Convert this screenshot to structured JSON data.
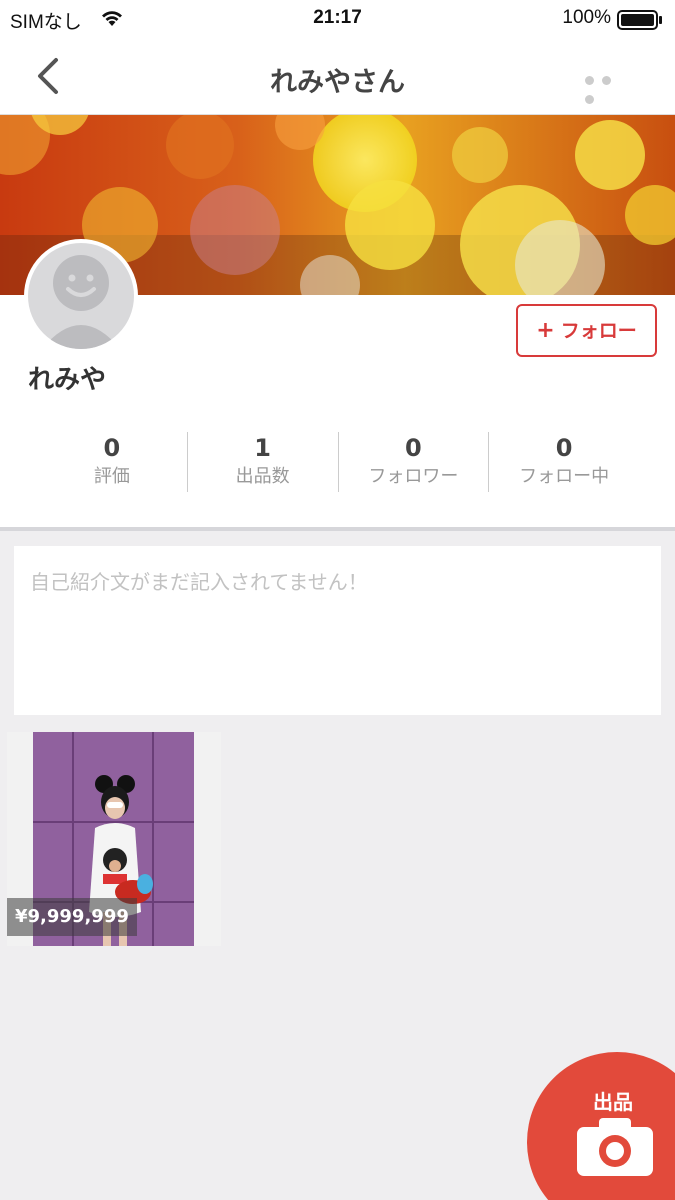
{
  "status_bar": {
    "carrier": "SIMなし",
    "time": "21:17",
    "battery_pct": "100%"
  },
  "nav": {
    "title": "れみやさん",
    "back_icon": "chevron-left-icon",
    "more_icon": "more-horizontal-icon"
  },
  "profile": {
    "name": "れみや",
    "follow_label": "フォロー",
    "follow_plus": "+"
  },
  "stats": [
    {
      "value": "0",
      "label": "評価"
    },
    {
      "value": "1",
      "label": "出品数"
    },
    {
      "value": "0",
      "label": "フォロワー"
    },
    {
      "value": "0",
      "label": "フォロー中"
    }
  ],
  "bio": {
    "placeholder": "自己紹介文がまだ記入されてません！"
  },
  "items": [
    {
      "price": "¥9,999,999"
    }
  ],
  "fab": {
    "label": "出品",
    "icon": "camera-icon"
  },
  "colors": {
    "accent": "#e24a3b",
    "follow_border": "#d83a3a",
    "background": "#efeef0"
  }
}
